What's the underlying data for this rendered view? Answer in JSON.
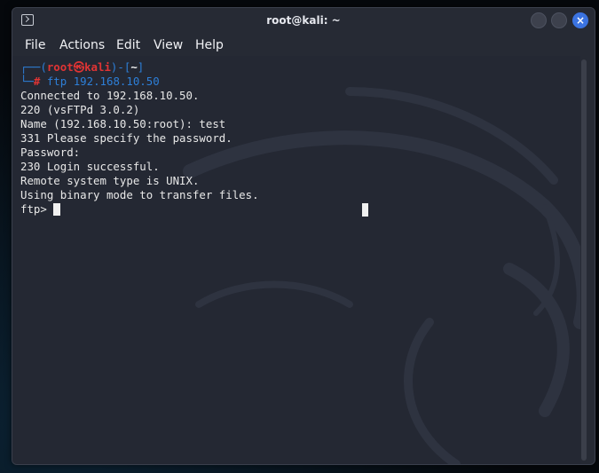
{
  "window": {
    "title": "root@kali: ~"
  },
  "menu": [
    "File",
    "Actions",
    "Edit",
    "View",
    "Help"
  ],
  "prompt": {
    "frame_top_left": "┌──(",
    "user": "root",
    "at_icon": "㉿",
    "host": "kali",
    "frame_mid": ")-[",
    "path": "~",
    "frame_end": "]",
    "frame_bottom": "└─",
    "hash": "#",
    "command": " ftp 192.168.10.50"
  },
  "output": [
    "Connected to 192.168.10.50.",
    "220 (vsFTPd 3.0.2)",
    "Name (192.168.10.50:root): test",
    "331 Please specify the password.",
    "Password:",
    "230 Login successful.",
    "Remote system type is UNIX.",
    "Using binary mode to transfer files."
  ],
  "ftp_prompt": "ftp> ",
  "colors": {
    "window_bg": "#262a34",
    "terminal_bg": "#242833",
    "prompt_blue": "#2d7fd8",
    "prompt_red": "#e03434",
    "close_button": "#3b73e0"
  },
  "icons": {
    "title": "terminal-icon",
    "close": "close-icon"
  }
}
